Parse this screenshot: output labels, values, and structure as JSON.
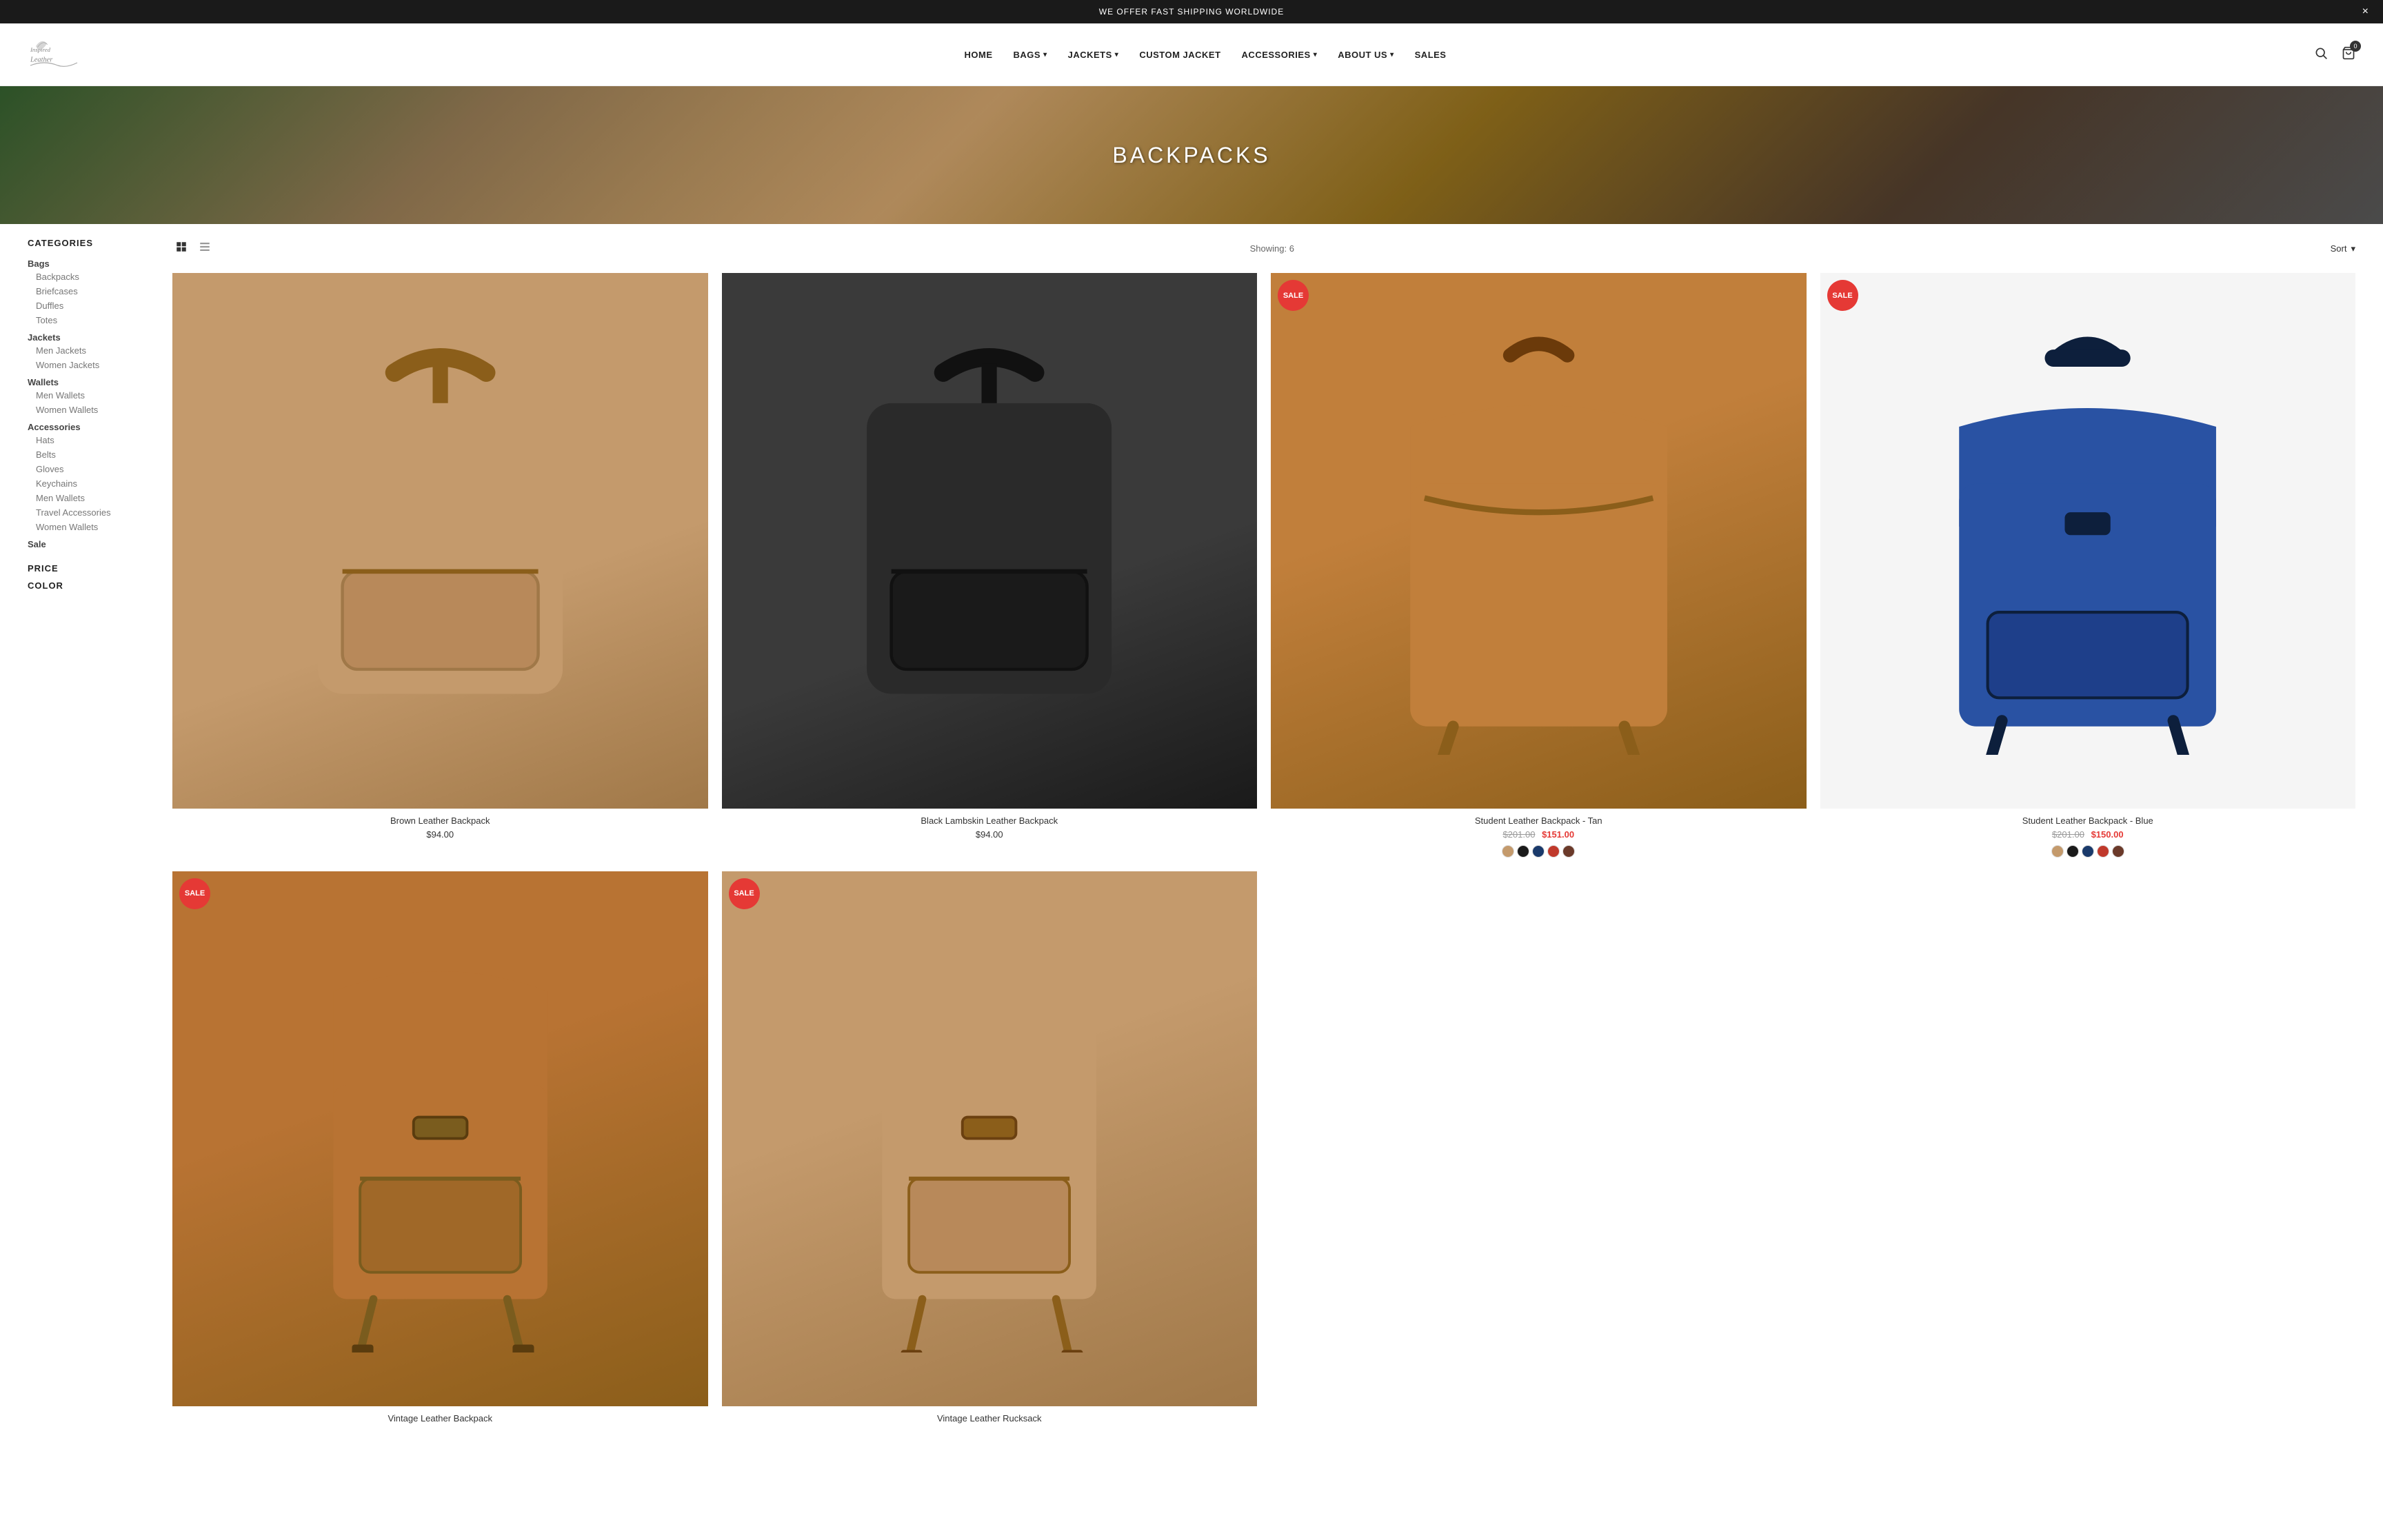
{
  "announcement": {
    "text": "WE OFFER FAST SHIPPING WORLDWIDE",
    "close_label": "×"
  },
  "header": {
    "logo_text": "Inspired Leather",
    "nav_items": [
      {
        "label": "HOME",
        "has_dropdown": false
      },
      {
        "label": "BAGS",
        "has_dropdown": true
      },
      {
        "label": "JACKETS",
        "has_dropdown": true
      },
      {
        "label": "CUSTOM JACKET",
        "has_dropdown": false
      },
      {
        "label": "ACCESSORIES",
        "has_dropdown": true
      },
      {
        "label": "ABOUT US",
        "has_dropdown": true
      },
      {
        "label": "SALES",
        "has_dropdown": false
      }
    ],
    "cart_count": "0"
  },
  "hero": {
    "title": "BACKPACKS"
  },
  "sidebar": {
    "categories_title": "CATEGORIES",
    "categories": [
      {
        "label": "Bags",
        "type": "parent"
      },
      {
        "label": "Backpacks",
        "type": "child"
      },
      {
        "label": "Briefcases",
        "type": "child"
      },
      {
        "label": "Duffles",
        "type": "child"
      },
      {
        "label": "Totes",
        "type": "child"
      },
      {
        "label": "Jackets",
        "type": "parent"
      },
      {
        "label": "Men Jackets",
        "type": "child"
      },
      {
        "label": "Women Jackets",
        "type": "child"
      },
      {
        "label": "Wallets",
        "type": "parent"
      },
      {
        "label": "Men Wallets",
        "type": "child"
      },
      {
        "label": "Women Wallets",
        "type": "child"
      },
      {
        "label": "Accessories",
        "type": "parent"
      },
      {
        "label": "Hats",
        "type": "child"
      },
      {
        "label": "Belts",
        "type": "child"
      },
      {
        "label": "Gloves",
        "type": "child"
      },
      {
        "label": "Keychains",
        "type": "child"
      },
      {
        "label": "Men Wallets",
        "type": "child"
      },
      {
        "label": "Travel Accessories",
        "type": "child"
      },
      {
        "label": "Women Wallets",
        "type": "child"
      },
      {
        "label": "Sale",
        "type": "parent"
      }
    ],
    "price_title": "PRICE",
    "color_title": "COLOR"
  },
  "toolbar": {
    "showing_text": "Showing: 6",
    "sort_label": "Sort"
  },
  "products": [
    {
      "id": 1,
      "name": "Brown Leather Backpack",
      "price": "$94.00",
      "original_price": null,
      "sale_price": null,
      "on_sale": false,
      "style": "brown-backpack",
      "swatches": []
    },
    {
      "id": 2,
      "name": "Black Lambskin Leather Backpack",
      "price": "$94.00",
      "original_price": null,
      "sale_price": null,
      "on_sale": false,
      "style": "black-backpack",
      "swatches": []
    },
    {
      "id": 3,
      "name": "Student Leather Backpack - Tan",
      "price": null,
      "original_price": "$201.00",
      "sale_price": "$151.00",
      "on_sale": true,
      "style": "tan-backpack",
      "swatches": [
        "tan",
        "black",
        "blue",
        "red",
        "brown"
      ]
    },
    {
      "id": 4,
      "name": "Student Leather Backpack - Blue",
      "price": null,
      "original_price": "$201.00",
      "sale_price": "$150.00",
      "on_sale": true,
      "style": "blue-backpack",
      "swatches": [
        "tan",
        "black",
        "blue",
        "red",
        "brown"
      ]
    },
    {
      "id": 5,
      "name": "Vintage Leather Backpack",
      "price": null,
      "original_price": null,
      "sale_price": null,
      "on_sale": true,
      "style": "vintage-tan1",
      "swatches": []
    },
    {
      "id": 6,
      "name": "Vintage Leather Rucksack",
      "price": null,
      "original_price": null,
      "sale_price": null,
      "on_sale": true,
      "style": "vintage-tan2",
      "swatches": []
    }
  ]
}
